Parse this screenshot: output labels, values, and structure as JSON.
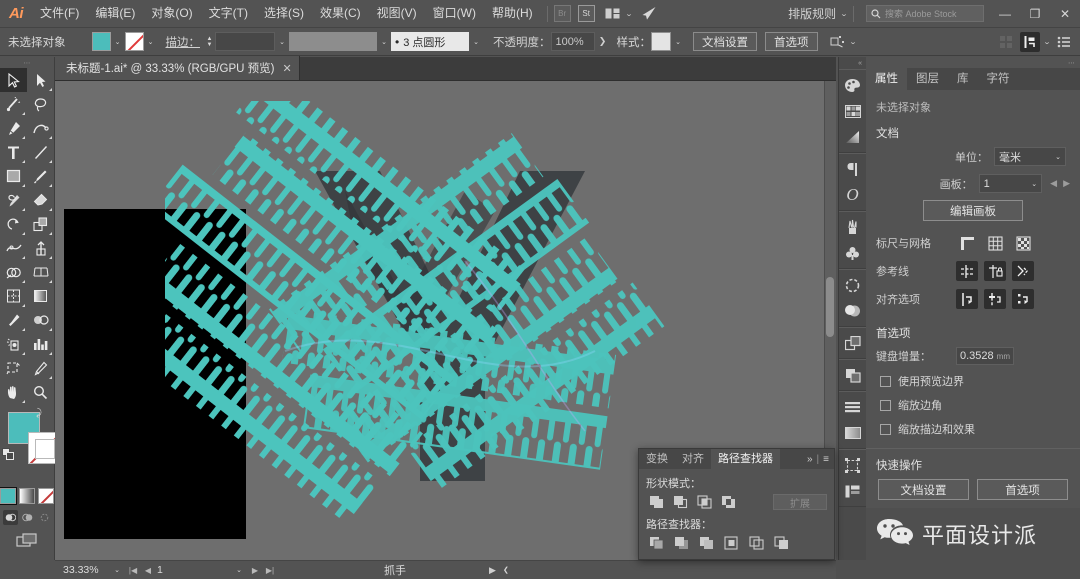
{
  "app": {
    "logo": "Ai",
    "accent": "#ff9a5c",
    "ui_bg": "#535353",
    "teal": "#4cbdbb"
  },
  "menubar": {
    "items": [
      "文件(F)",
      "编辑(E)",
      "对象(O)",
      "文字(T)",
      "选择(S)",
      "效果(C)",
      "视图(V)",
      "窗口(W)",
      "帮助(H)"
    ],
    "badge_br": "Br",
    "badge_st": "St",
    "arrange_label": "排版规则",
    "search_placeholder": "搜索 Adobe Stock",
    "minimize": "—",
    "restore": "❐",
    "close": "✕"
  },
  "controlbar": {
    "selection_label": "未选择对象",
    "stroke_label": "描边：",
    "stroke_weight": "",
    "stroke_profile_value": "3 点圆形",
    "opacity_label": "不透明度：",
    "opacity_value": "100%",
    "style_label": "样式：",
    "doc_setup_button": "文档设置",
    "preferences_button": "首选项"
  },
  "toolbar": {
    "tools": [
      "selection-tool",
      "direct-selection-tool",
      "magic-wand-tool",
      "lasso-tool",
      "pen-tool",
      "curvature-tool",
      "type-tool",
      "line-segment-tool",
      "rectangle-tool",
      "paintbrush-tool",
      "shaper-tool",
      "eraser-tool",
      "rotate-tool",
      "scale-tool",
      "width-tool",
      "free-transform-tool",
      "shape-builder-tool",
      "perspective-grid-tool",
      "mesh-tool",
      "gradient-tool",
      "eyedropper-tool",
      "blend-tool",
      "symbol-sprayer-tool",
      "column-graph-tool",
      "artboard-tool",
      "slice-tool",
      "hand-tool",
      "zoom-tool"
    ],
    "fill_color": "#4cbdbb",
    "stroke_color": "none",
    "color_modes": [
      "color-swatch",
      "gradient-swatch",
      "none-swatch"
    ],
    "draw_modes": [
      "draw-normal",
      "draw-behind",
      "draw-inside"
    ],
    "screen_mode": "change-screen-mode"
  },
  "tab": {
    "title": "未标题-1.ai* @ 33.33% (RGB/GPU 预览)",
    "close": "✕"
  },
  "statusbar": {
    "zoom": "33.33%",
    "page": "1",
    "tool": "抓手"
  },
  "icondock": {
    "icons": [
      "color-panel-icon",
      "swatches-panel-icon",
      "gradient-panel-icon",
      "paragraph-panel-icon",
      "character-panel-icon",
      "brushes-panel-icon",
      "symbols-panel-icon",
      "stroke-panel-icon",
      "appearance-panel-icon",
      "transform-panel-icon",
      "pathfinder-panel-icon",
      "align-panel-icon",
      "artboards-panel-icon",
      "layers-panel-icon",
      "asset-export-icon"
    ]
  },
  "properties": {
    "tabs": [
      "属性",
      "图层",
      "库",
      "字符"
    ],
    "active_tab": "属性",
    "no_selection": "未选择对象",
    "document_section": "文档",
    "units_label": "单位：",
    "units_value": "毫米",
    "artboard_label": "画板：",
    "artboard_value": "1",
    "edit_artboards_button": "编辑画板",
    "rulers_grid_label": "标尺与网格",
    "rulers_grid_icons": [
      "show-rulers-icon",
      "show-grid-icon",
      "show-transparency-grid-icon"
    ],
    "guides_label": "参考线",
    "guides_icons": [
      "show-guides-icon",
      "lock-guides-icon",
      "release-guides-icon"
    ],
    "snap_label": "对齐选项",
    "snap_icons": [
      "snap-to-point-icon",
      "snap-to-grid-icon",
      "smart-guides-icon"
    ],
    "prefs_section": "首选项",
    "keyboard_increment_label": "键盘增量：",
    "keyboard_increment_value": "0.3528",
    "keyboard_increment_unit": "mm",
    "checkboxes": [
      "使用预览边界",
      "缩放边角",
      "缩放描边和效果"
    ],
    "quick_actions_label": "快速操作",
    "quick_actions": [
      "文档设置",
      "首选项"
    ]
  },
  "pathfinder": {
    "tabs": [
      "变换",
      "对齐",
      "路径查找器"
    ],
    "active_tab": "路径查找器",
    "expand_control": "»",
    "menu_control": "≡",
    "shape_modes_label": "形状模式：",
    "shape_modes": [
      "unite-icon",
      "minus-front-icon",
      "intersect-icon",
      "exclude-icon"
    ],
    "expand_button": "扩展",
    "pathfinders_label": "路径查找器：",
    "pathfinders": [
      "divide-icon",
      "trim-icon",
      "merge-icon",
      "crop-icon",
      "outline-icon",
      "minus-back-icon"
    ]
  },
  "watermark": {
    "logo": "wechat-icon",
    "text": "平面设计派"
  },
  "artwork": {
    "artboard_fill": "#000000",
    "stroke_color": "#4cbdbb",
    "letter_color": "#3b3f42",
    "description": "teal comb-pattern brush strokes over a dark letter form"
  }
}
